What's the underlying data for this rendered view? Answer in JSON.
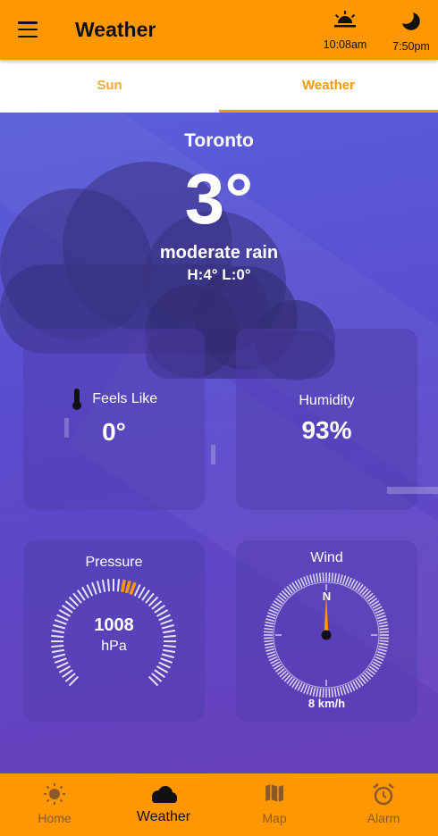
{
  "app": {
    "title": "Weather"
  },
  "header": {
    "sunrise_time": "10:08am",
    "sunset_time": "7:50pm"
  },
  "tabs": [
    {
      "label": "Sun",
      "active": false
    },
    {
      "label": "Weather",
      "active": true
    }
  ],
  "current": {
    "city": "Toronto",
    "temperature": "3°",
    "condition": "moderate rain",
    "high_low": "H:4°  L:0°"
  },
  "feels_like": {
    "label": "Feels Like",
    "value": "0°"
  },
  "humidity": {
    "label": "Humidity",
    "value": "93%"
  },
  "pressure": {
    "label": "Pressure",
    "value": "1008",
    "unit": "hPa",
    "level": 0.55
  },
  "wind": {
    "label": "Wind",
    "direction_label": "N",
    "speed": "8 km/h",
    "direction_deg": 0
  },
  "bottom_nav": [
    {
      "label": "Home",
      "icon": "sun-icon",
      "active": false
    },
    {
      "label": "Weather",
      "icon": "cloud-icon",
      "active": true
    },
    {
      "label": "Map",
      "icon": "map-icon",
      "active": false
    },
    {
      "label": "Alarm",
      "icon": "alarm-clock-icon",
      "active": false
    }
  ],
  "colors": {
    "accent": "#ff9800",
    "background": "#5a4bcc",
    "text": "#ffffff"
  }
}
